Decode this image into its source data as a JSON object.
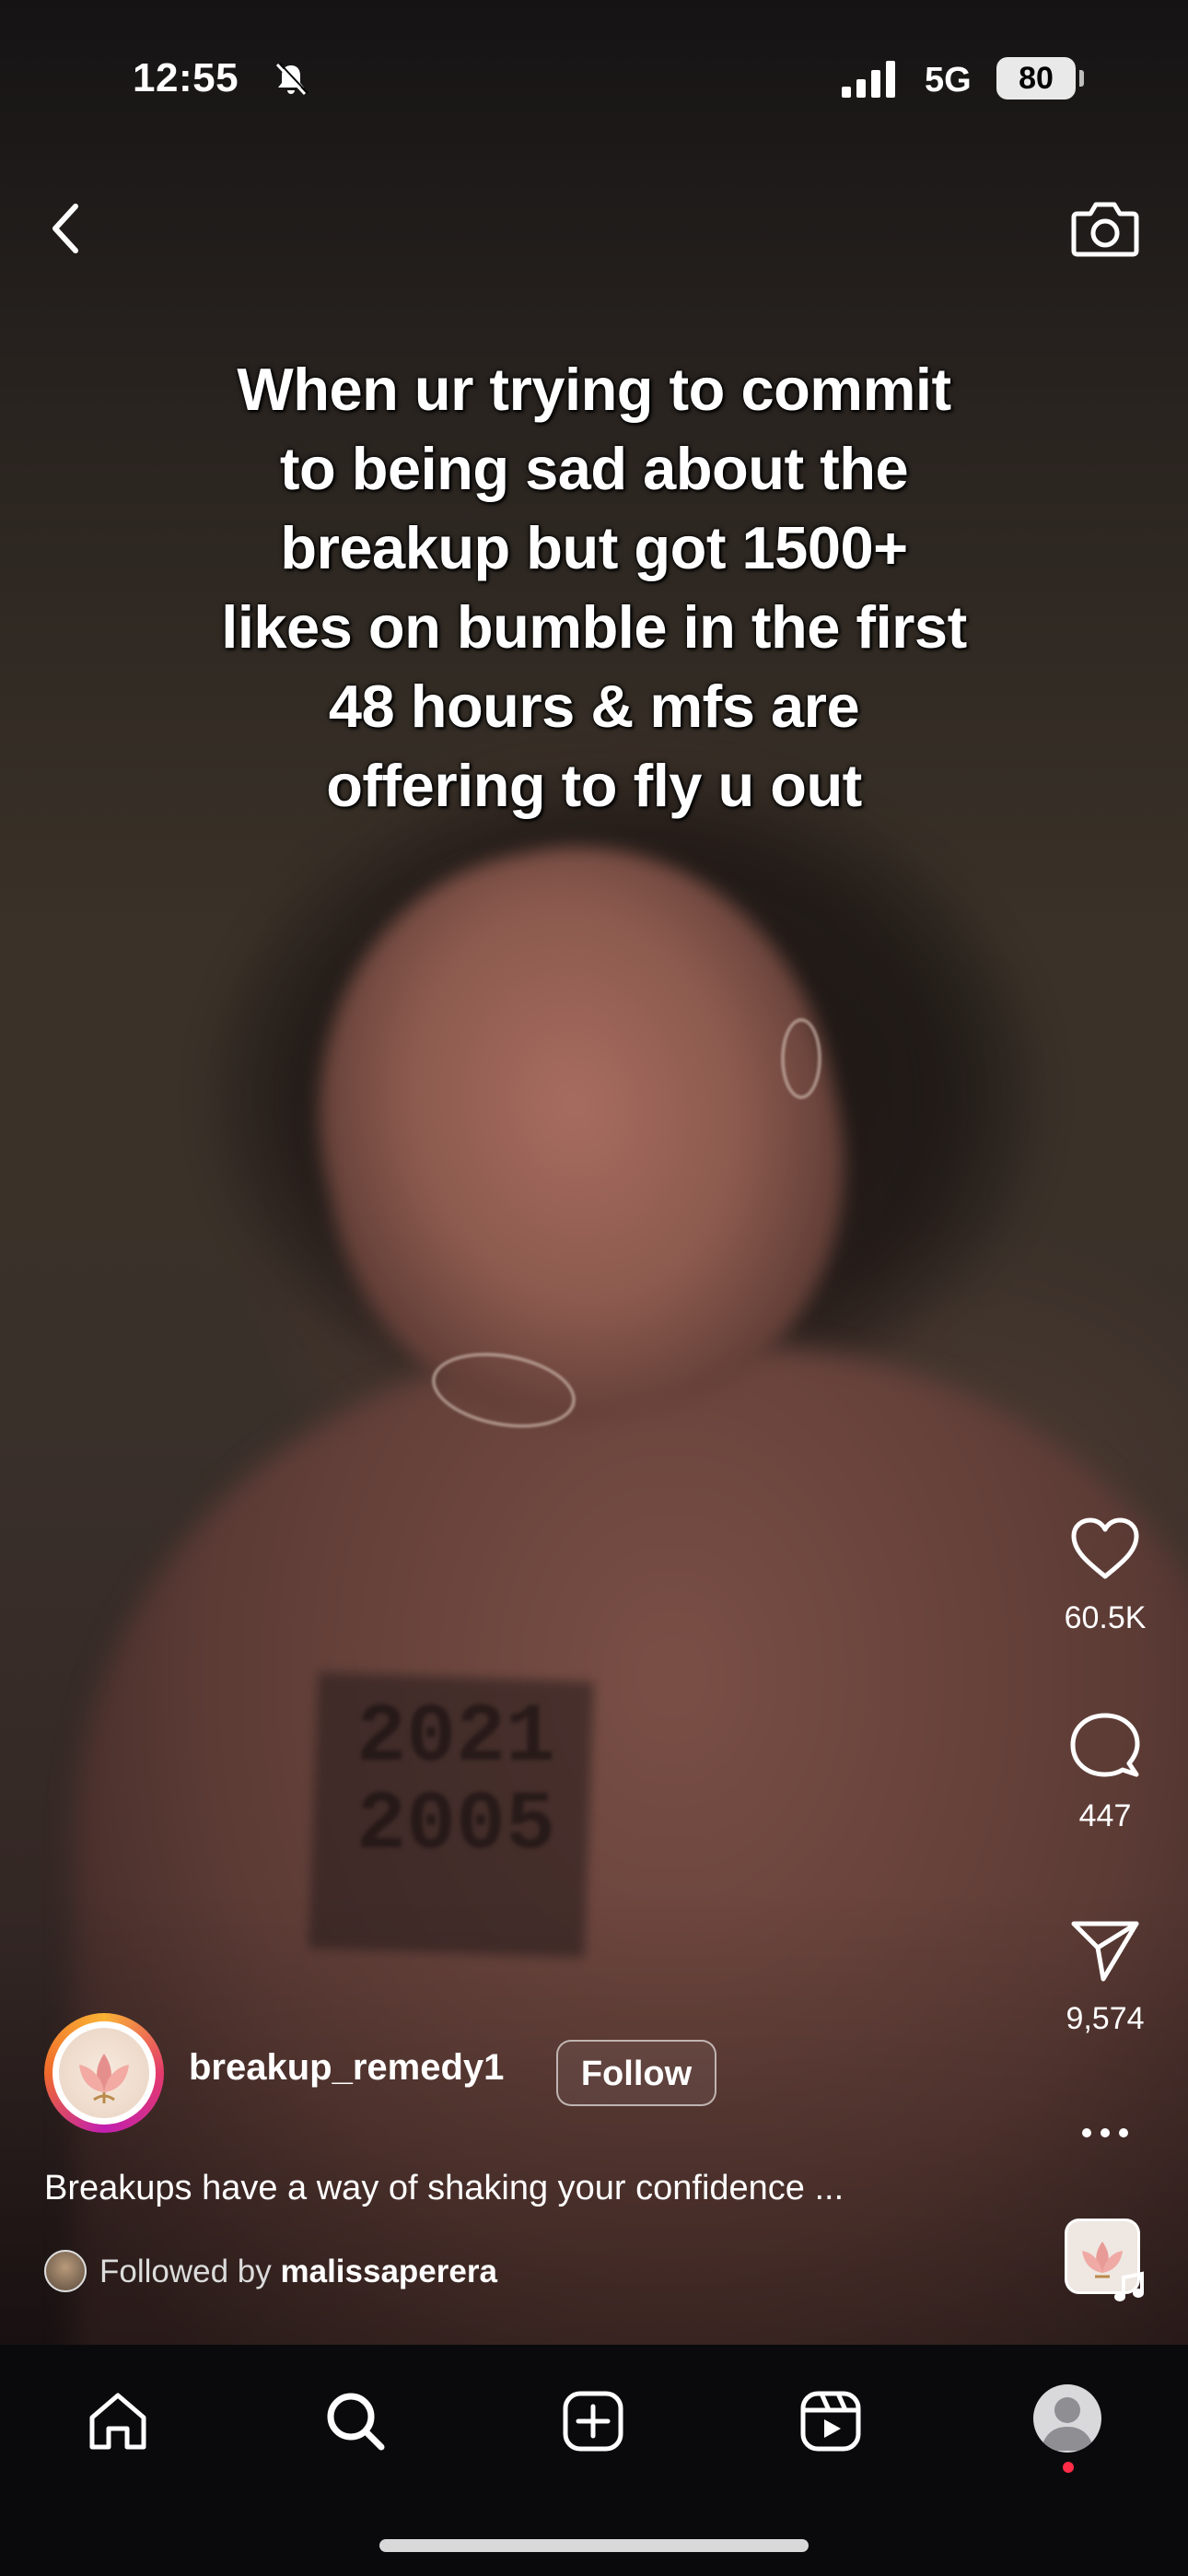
{
  "status_bar": {
    "time": "12:55",
    "network": "5G",
    "battery": "80"
  },
  "header": {
    "back_icon": "chevron-left-icon",
    "camera_icon": "camera-icon"
  },
  "reel": {
    "overlay_text": "When ur trying to commit\nto being sad about the\nbreakup but got 1500+\nlikes on bumble in the first\n48 hours & mfs are\noffering to fly u out",
    "shirt_print": "2021\n2005"
  },
  "actions": {
    "likes": "60.5K",
    "comments": "447",
    "shares": "9,574"
  },
  "author": {
    "username": "breakup_remedy1",
    "follow_label": "Follow",
    "caption": "Breakups have a way of shaking your confidence ...",
    "followed_by_prefix": "Followed by",
    "followed_by_user": "malissaperera"
  },
  "nav": {
    "items": [
      "home-icon",
      "search-icon",
      "create-icon",
      "reels-icon",
      "profile-avatar"
    ]
  },
  "colors": {
    "story_ring": "#e33b6c",
    "notification_dot": "#ff2b47"
  }
}
